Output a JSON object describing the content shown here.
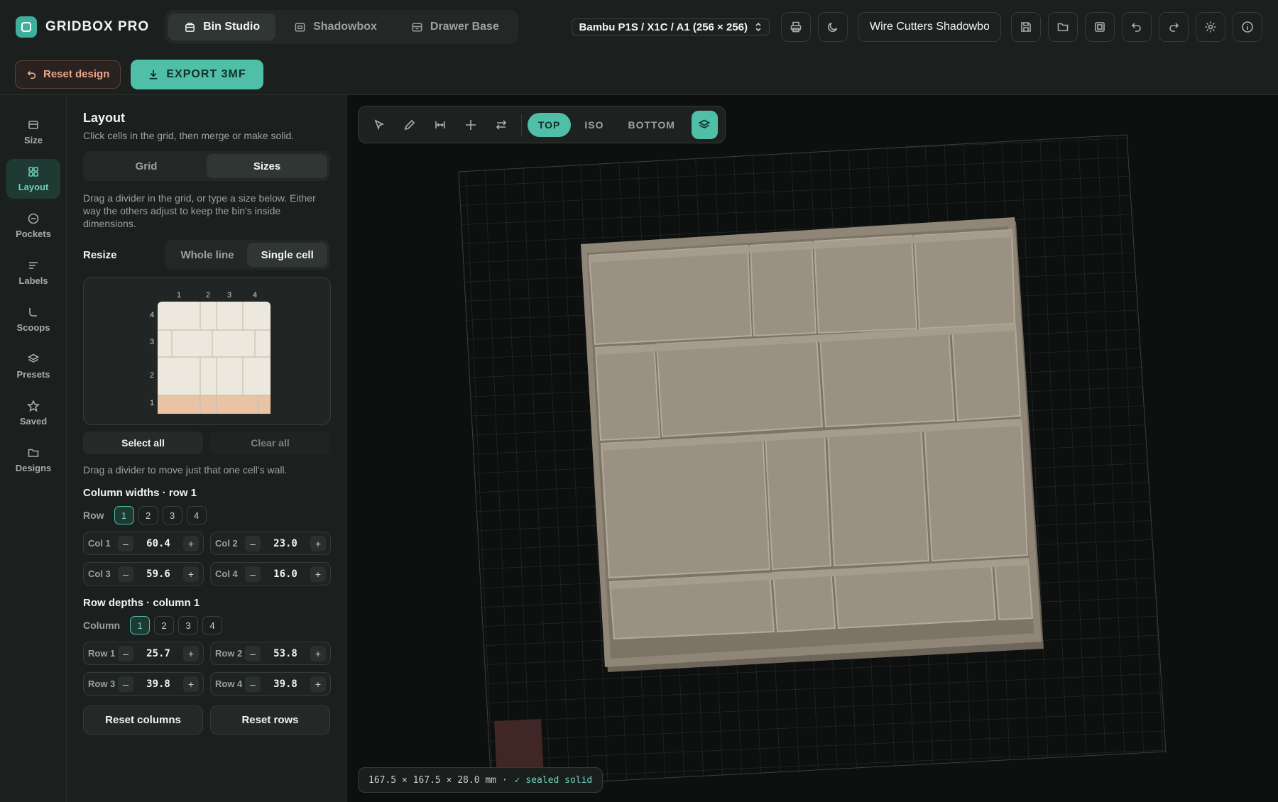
{
  "app": {
    "name": "GRIDBOX PRO"
  },
  "tabs": [
    {
      "label": "Bin Studio",
      "icon": "bin-icon",
      "active": true
    },
    {
      "label": "Shadowbox",
      "icon": "shadowbox-icon",
      "active": false
    },
    {
      "label": "Drawer Base",
      "icon": "drawer-icon",
      "active": false
    }
  ],
  "printer": {
    "selected": "Bambu P1S / X1C / A1 (256 × 256)"
  },
  "design_name": {
    "value": "Wire Cutters Shadowbo"
  },
  "actions": {
    "reset_label": "Reset design",
    "export_label": "EXPORT 3MF"
  },
  "rail": [
    {
      "label": "Size",
      "icon": "size-icon",
      "active": false
    },
    {
      "label": "Layout",
      "icon": "layout-icon",
      "active": true
    },
    {
      "label": "Pockets",
      "icon": "pockets-icon",
      "active": false
    },
    {
      "label": "Labels",
      "icon": "labels-icon",
      "active": false
    },
    {
      "label": "Scoops",
      "icon": "scoops-icon",
      "active": false
    },
    {
      "label": "Presets",
      "icon": "presets-icon",
      "active": false
    },
    {
      "label": "Saved",
      "icon": "star-icon",
      "active": false
    },
    {
      "label": "Designs",
      "icon": "folder-icon",
      "active": false
    }
  ],
  "panel": {
    "title": "Layout",
    "subtitle": "Click cells in the grid, then merge or make solid.",
    "mode_tabs": [
      "Grid",
      "Sizes"
    ],
    "mode_active": "Sizes",
    "description": "Drag a divider in the grid, or type a size below. Either way the others adjust to keep the bin's inside dimensions.",
    "resize_label": "Resize",
    "resize_options": [
      "Whole line",
      "Single cell"
    ],
    "resize_active": "Single cell",
    "grid_col_labels": [
      "1",
      "2",
      "3",
      "4"
    ],
    "grid_row_labels": [
      "4",
      "3",
      "2",
      "1"
    ],
    "select_all": "Select all",
    "clear_all": "Clear all",
    "hint": "Drag a divider to move just that one cell's wall.",
    "col_title": "Column widths · row 1",
    "row_picker_label": "Row",
    "row_picker": [
      "1",
      "2",
      "3",
      "4"
    ],
    "cols": [
      {
        "name": "Col 1",
        "value": "60.4"
      },
      {
        "name": "Col 2",
        "value": "23.0"
      },
      {
        "name": "Col 3",
        "value": "59.6"
      },
      {
        "name": "Col 4",
        "value": "16.0"
      }
    ],
    "row_title": "Row depths · column 1",
    "col_picker_label": "Column",
    "col_picker": [
      "1",
      "2",
      "3",
      "4"
    ],
    "rows": [
      {
        "name": "Row 1",
        "value": "25.7"
      },
      {
        "name": "Row 2",
        "value": "53.8"
      },
      {
        "name": "Row 3",
        "value": "39.8"
      },
      {
        "name": "Row 4",
        "value": "39.8"
      }
    ],
    "reset_columns": "Reset columns",
    "reset_rows": "Reset rows"
  },
  "viewport": {
    "views": [
      "TOP",
      "ISO",
      "BOTTOM"
    ],
    "active_view": "TOP",
    "status_dims": "167.5 × 167.5 × 28.0 mm ·",
    "status_ok": "✓ sealed solid"
  }
}
